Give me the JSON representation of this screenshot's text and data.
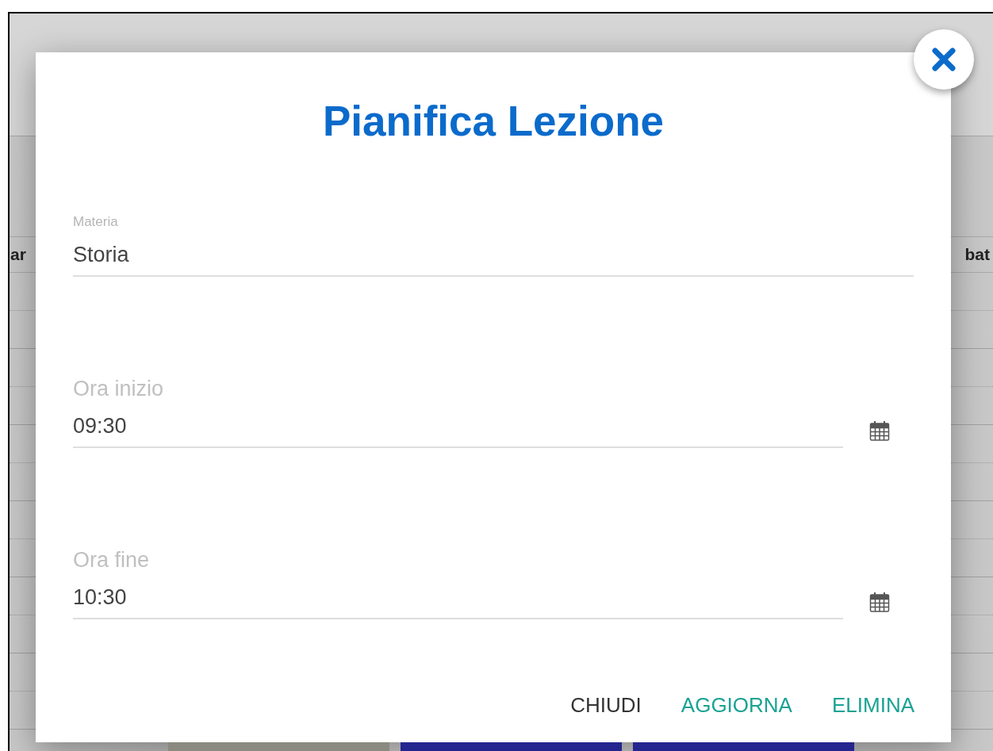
{
  "background": {
    "day_headers": [
      "ar",
      "bat"
    ],
    "events": [
      {
        "color": "#8a8a80"
      },
      {
        "color": "#25258f"
      },
      {
        "color": "#25258f"
      }
    ]
  },
  "dialog": {
    "title": "Pianifica Lezione",
    "fields": [
      {
        "kind": "text",
        "label": "Materia",
        "value": "Storia"
      },
      {
        "kind": "time",
        "label": "Ora inizio",
        "value": "09:30"
      },
      {
        "kind": "time",
        "label": "Ora fine",
        "value": "10:30"
      }
    ],
    "buttons": [
      {
        "kind": "neutral",
        "label": "CHIUDI"
      },
      {
        "kind": "primary",
        "label": "AGGIORNA"
      },
      {
        "kind": "primary",
        "label": "ELIMINA"
      }
    ]
  }
}
